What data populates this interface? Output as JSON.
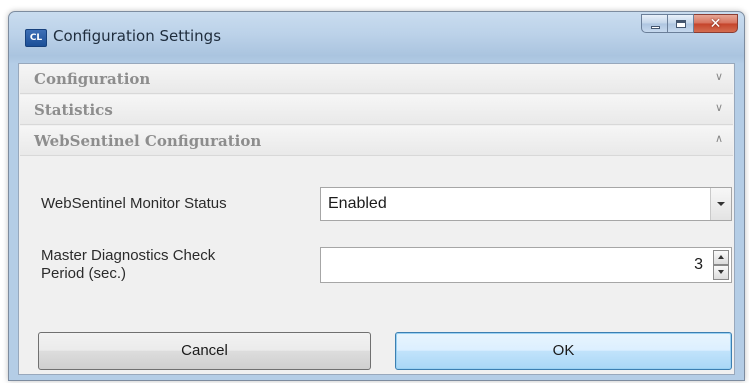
{
  "window": {
    "title": "Configuration Settings",
    "app_icon_text": "CL"
  },
  "sections": {
    "configuration": {
      "label": "Configuration",
      "icon": "chevron-down-icon",
      "expanded": false
    },
    "statistics": {
      "label": "Statistics",
      "icon": "chevron-down-icon",
      "expanded": false
    },
    "websentinel": {
      "label": "WebSentinel Configuration",
      "icon": "chevron-up-icon",
      "expanded": true
    }
  },
  "fields": {
    "monitor_status": {
      "label": "WebSentinel Monitor Status",
      "value": "Enabled"
    },
    "check_period": {
      "label_line1": "Master Diagnostics Check",
      "label_line2": "Period (sec.)",
      "value": "3"
    }
  },
  "buttons": {
    "cancel": "Cancel",
    "ok": "OK"
  }
}
